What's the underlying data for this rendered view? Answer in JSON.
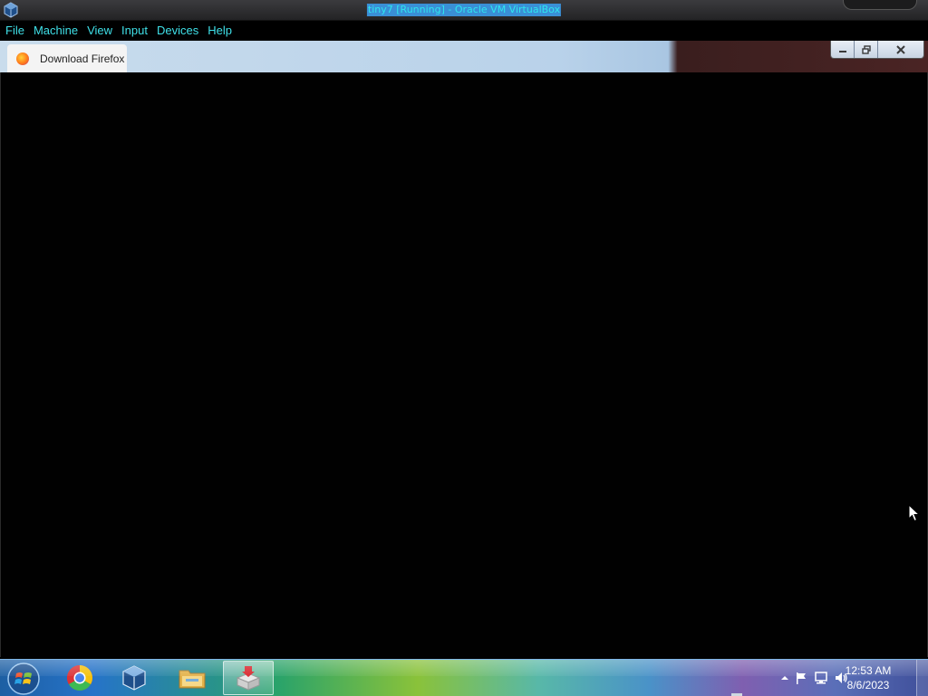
{
  "window": {
    "title": "tiny7 [Running] - Oracle VM VirtualBox"
  },
  "menu": {
    "items": [
      {
        "label": "File"
      },
      {
        "label": "Machine"
      },
      {
        "label": "View"
      },
      {
        "label": "Input"
      },
      {
        "label": "Devices"
      },
      {
        "label": "Help"
      }
    ]
  },
  "guest": {
    "browser_tab_label": "Download Firefox f",
    "caption_buttons": [
      "minimize-icon",
      "restore-icon",
      "close-icon"
    ]
  },
  "taskbar": {
    "pinned": [
      {
        "name": "chrome",
        "icon": "chrome-icon"
      },
      {
        "name": "virtualbox",
        "icon": "virtualbox-icon"
      },
      {
        "name": "file-explorer",
        "icon": "folder-icon"
      },
      {
        "name": "installer",
        "icon": "installer-icon",
        "active": true
      }
    ],
    "tray_icons": [
      "show-hidden-icons-arrow",
      "action-center-flag-icon",
      "network-icon",
      "volume-icon"
    ],
    "clock": {
      "time": "12:53 AM",
      "date": "8/6/2023"
    }
  },
  "colors": {
    "menu_text": "#3fe0e8",
    "title_text": "#2ee6ee",
    "title_highlight": "#3a8fd6"
  }
}
